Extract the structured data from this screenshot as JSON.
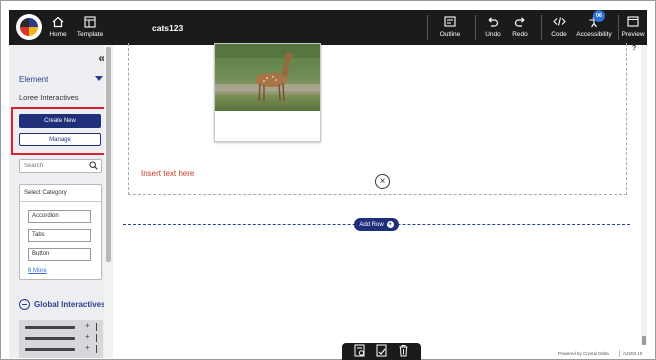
{
  "toolbar": {
    "home_label": "Home",
    "template_label": "Template",
    "doc_title": "cats123",
    "outline_label": "Outline",
    "undo_label": "Undo",
    "redo_label": "Redo",
    "code_label": "Code",
    "accessibility_label": "Accessibility",
    "accessibility_badge": "06",
    "preview_label": "Preview"
  },
  "sidebar": {
    "collapse_icon": "double-chevron-left-icon",
    "element_label": "Element",
    "loree_label": "Loree Interactives",
    "create_new_label": "Create New",
    "manage_label": "Manage",
    "search_placeholder": "Search",
    "category_title": "Select Category",
    "categories": [
      "Accordion",
      "Tabs",
      "Button"
    ],
    "more_link": "6 More",
    "global_label": "Global Interactives"
  },
  "canvas": {
    "insert_text": "Insert text here",
    "add_row_label": "Add Row"
  },
  "footer": {
    "powered_by": "Powered by Crystal Delta",
    "version": "A2203.10"
  },
  "colors": {
    "toolbar_bg": "#1b1b1b",
    "brand_navy": "#1f2f7a",
    "highlight_red": "#d9232e",
    "insert_text_red": "#c0392b",
    "badge_blue": "#2c6fd6"
  }
}
